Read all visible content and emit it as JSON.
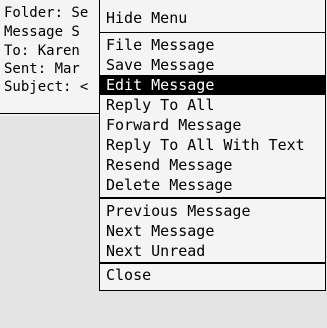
{
  "header": {
    "folder": "Folder: Se",
    "message": "Message S",
    "to": "To: Karen",
    "sent": "Sent: Mar",
    "subject": "Subject: <"
  },
  "menu": {
    "title": "Hide Menu",
    "items": [
      {
        "label": "File Message"
      },
      {
        "label": "Save Message"
      },
      {
        "label": "Edit Message",
        "selected": true
      },
      {
        "label": "Reply To All"
      },
      {
        "label": "Forward Message"
      },
      {
        "label": "Reply To All With Text"
      },
      {
        "label": "Resend Message"
      },
      {
        "label": "Delete Message"
      },
      {
        "label": "Previous Message"
      },
      {
        "label": "Next Message"
      },
      {
        "label": "Next Unread"
      },
      {
        "label": "Close"
      }
    ]
  },
  "colors": {
    "background": "#e4e4e4",
    "menu_background": "#f4f4f4",
    "selection": "#000000",
    "selection_text": "#ffffff"
  }
}
